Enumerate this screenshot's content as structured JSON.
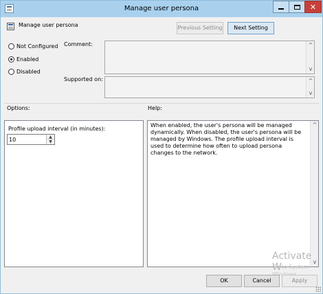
{
  "window": {
    "title": "Manage user persona"
  },
  "header": {
    "title": "Manage user persona",
    "prev_label": "Previous Setting",
    "next_label": "Next Setting"
  },
  "state": {
    "options": [
      {
        "label": "Not Configured",
        "checked": false
      },
      {
        "label": "Enabled",
        "checked": true
      },
      {
        "label": "Disabled",
        "checked": false
      }
    ]
  },
  "comment": {
    "label": "Comment:"
  },
  "supported": {
    "label": "Supported on:"
  },
  "options_section": {
    "label": "Options:",
    "interval_label": "Profile upload interval (in minutes):",
    "interval_value": "10"
  },
  "help_section": {
    "label": "Help:",
    "text": "When enabled, the user's persona will be managed dynamically. When disabled, the user's persona will be managed by Windows. The profile upload interval is used to determine how often to upload persona changes to the network."
  },
  "watermark": {
    "line1": "Activate W",
    "line2": "Go to System",
    "line3": "Windows."
  },
  "footer": {
    "ok_label": "OK",
    "cancel_label": "Cancel",
    "apply_label": "Apply"
  }
}
